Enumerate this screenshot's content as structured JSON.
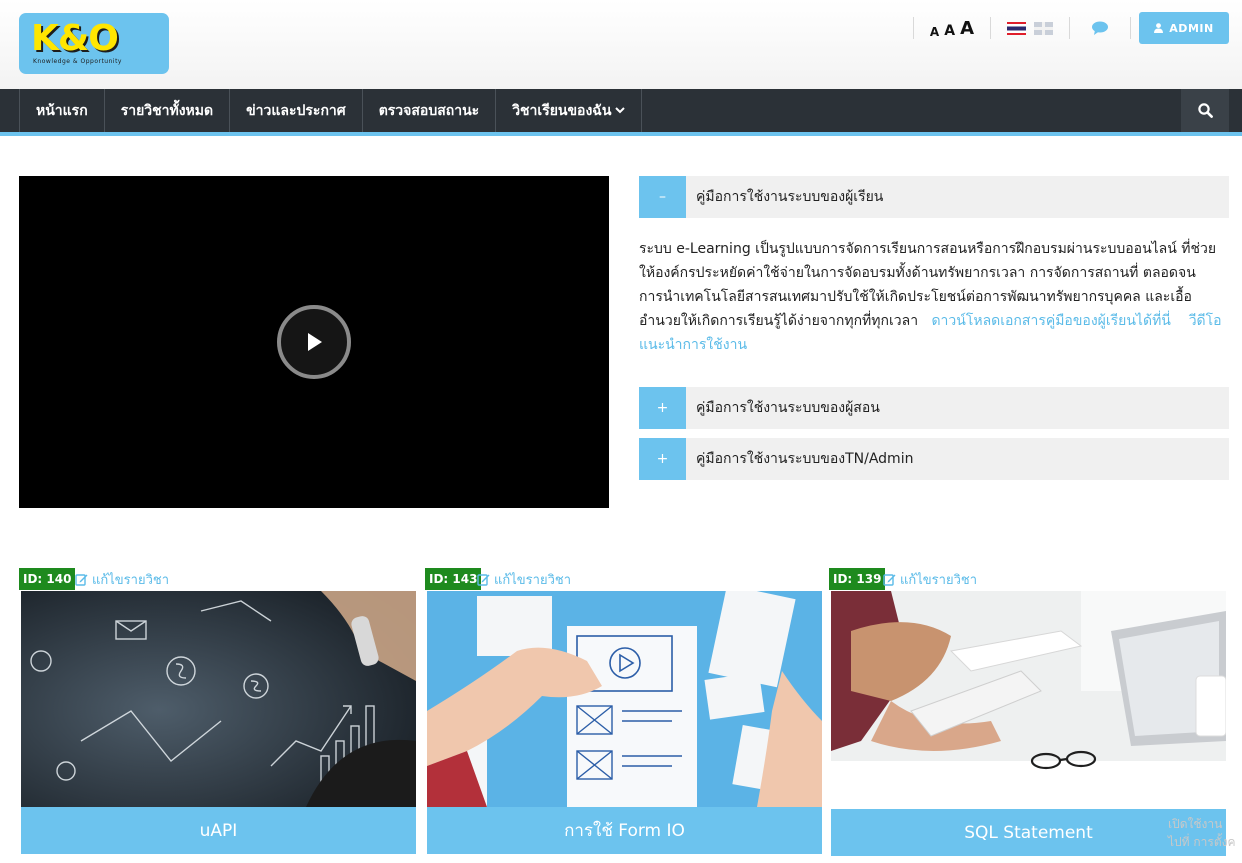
{
  "header": {
    "logo_text": "K&O",
    "logo_subtext": "Knowledge & Opportunity",
    "font_size_labels": [
      "A",
      "A",
      "A"
    ],
    "admin_label": "ADMIN"
  },
  "nav": {
    "items": [
      {
        "label": "หน้าแรก"
      },
      {
        "label": "รายวิชาทั้งหมด"
      },
      {
        "label": "ข่าวและประกาศ"
      },
      {
        "label": "ตรวจสอบสถานะ"
      },
      {
        "label": "วิชาเรียนของฉัน"
      }
    ]
  },
  "accordion": [
    {
      "toggle": "–",
      "title": "คู่มือการใช้งานระบบของผู้เรียน",
      "body": "ระบบ e-Learning เป็นรูปแบบการจัดการเรียนการสอนหรือการฝึกอบรมผ่านระบบออนไลน์ ที่ช่วยให้องค์กรประหยัดค่าใช้จ่ายในการจัดอบรมทั้งด้านทรัพยากรเวลา การจัดการสถานที่ ตลอดจนการนำเทคโนโลยีสารสนเทศมาปรับใช้ให้เกิดประโยชน์ต่อการพัฒนาทรัพยากรบุคคล และเอื้ออำนวยให้เกิดการเรียนรู้ได้ง่ายจากทุกที่ทุกเวลา",
      "link1": "ดาวน์โหลดเอกสารคู่มือของผู้เรียนได้ที่นี่",
      "link2": "วีดีโอแนะนำการใช้งาน"
    },
    {
      "toggle": "+",
      "title": "คู่มือการใช้งานระบบของผู้สอน"
    },
    {
      "toggle": "+",
      "title": "คู่มือการใช้งานระบบของTN/Admin"
    }
  ],
  "courses": [
    {
      "id": "ID: 140",
      "edit": "แก้ไขรายวิชา",
      "title": "uAPI"
    },
    {
      "id": "ID: 143",
      "edit": "แก้ไขรายวิชา",
      "title": "การใช้ Form IO"
    },
    {
      "id": "ID: 139",
      "edit": "แก้ไขรายวิชา",
      "title": "SQL Statement"
    }
  ],
  "watermark": {
    "line1": "เปิดใช้งาน",
    "line2": "ไปที่ การตั้งค"
  },
  "colors": {
    "accent": "#6cc3ee",
    "nav_bg": "#2b3137",
    "id_badge": "#1e8a1e",
    "link": "#5bbbe8"
  }
}
